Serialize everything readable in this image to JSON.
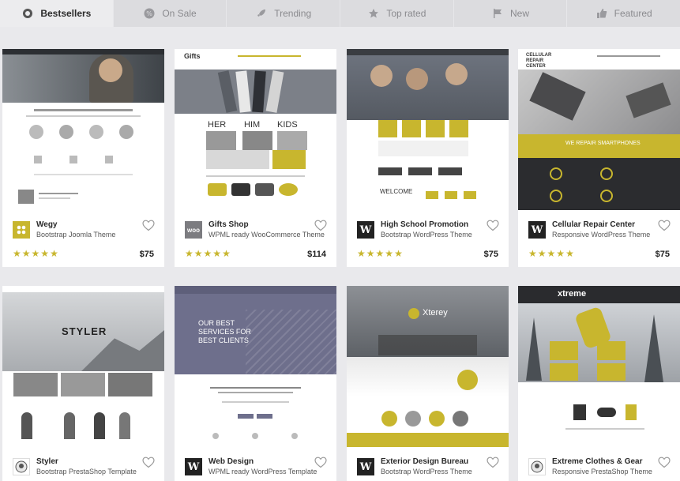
{
  "tabs": [
    {
      "label": "Bestsellers",
      "icon": "badge-icon",
      "active": true
    },
    {
      "label": "On Sale",
      "icon": "percent-icon",
      "active": false
    },
    {
      "label": "Trending",
      "icon": "rocket-icon",
      "active": false
    },
    {
      "label": "Top rated",
      "icon": "star-icon",
      "active": false
    },
    {
      "label": "New",
      "icon": "flag-icon",
      "active": false
    },
    {
      "label": "Featured",
      "icon": "thumbs-up-icon",
      "active": false
    }
  ],
  "accent": "#c8b62e",
  "cards": [
    {
      "title": "Wegy",
      "subtitle": "Bootstrap Joomla Theme",
      "price": "$75",
      "rating": 5,
      "logo": "joomla-icon"
    },
    {
      "title": "Gifts Shop",
      "subtitle": "WPML ready WooCommerce Theme",
      "price": "$114",
      "rating": 5,
      "logo": "woocommerce-icon"
    },
    {
      "title": "High School Promotion",
      "subtitle": "Bootstrap WordPress Theme",
      "price": "$75",
      "rating": 5,
      "logo": "wordpress-icon"
    },
    {
      "title": "Cellular Repair Center",
      "subtitle": "Responsive WordPress Theme",
      "price": "$75",
      "rating": 5,
      "logo": "wordpress-icon"
    },
    {
      "title": "Styler",
      "subtitle": "Bootstrap PrestaShop Template",
      "logo": "prestashop-icon"
    },
    {
      "title": "Web Design",
      "subtitle": "WPML ready WordPress Template",
      "logo": "wordpress-icon"
    },
    {
      "title": "Exterior Design Bureau",
      "subtitle": "Bootstrap WordPress Theme",
      "logo": "wordpress-icon"
    },
    {
      "title": "Extreme Clothes & Gear",
      "subtitle": "Responsive PrestaShop Theme",
      "logo": "prestashop-icon"
    }
  ],
  "previews": {
    "p2_brand": "Gifts",
    "p2_her": "HER",
    "p2_him": "HIM",
    "p2_kids": "KIDS",
    "p3_welcome": "WELCOME",
    "p4_brand": "CELLULAR REPAIR CENTER",
    "p4_repair": "WE REPAIR SMARTPHONES",
    "p5_brand": "STYLER",
    "p6_headline": "OUR BEST SERVICES FOR BEST CLIENTS",
    "p7_brand": "Xterey",
    "p8_brand": "xtreme"
  }
}
